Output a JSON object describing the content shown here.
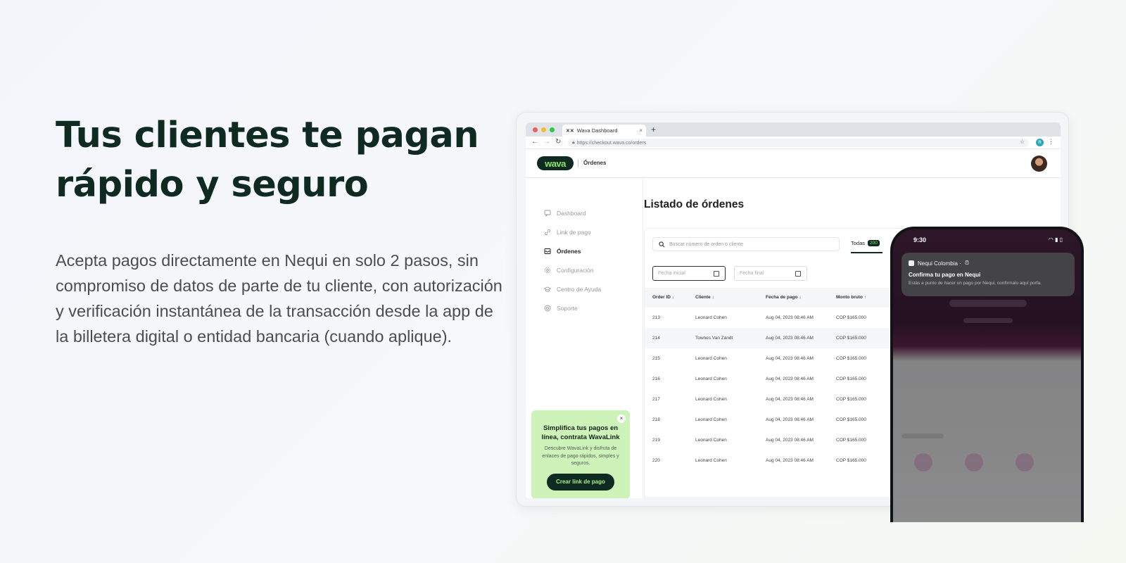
{
  "hero": {
    "title_line1": "Tus clientes te pagan",
    "title_line2": "rápido y seguro",
    "description": "Acepta pagos directamente en Nequi en solo 2 pasos, sin compromiso de datos de parte de tu cliente, con autorización y verificación instantánea de la transacción desde la app de la billetera digital o entidad bancaria (cuando aplique)."
  },
  "browser": {
    "tab_title": "Wava Dashboard",
    "url": "https://checkout.wava.co/orders",
    "profile_initial": "R"
  },
  "app": {
    "logo": "wava",
    "header_section": "Órdenes",
    "sidebar": [
      {
        "label": "Dashboard",
        "icon": "chat-icon",
        "active": false
      },
      {
        "label": "Link de pago",
        "icon": "link-icon",
        "active": false
      },
      {
        "label": "Órdenes",
        "icon": "inbox-icon",
        "active": true
      },
      {
        "label": "Configuración",
        "icon": "gear-icon",
        "active": false
      },
      {
        "label": "Centro de Ayuda",
        "icon": "graduation-cap-icon",
        "active": false
      },
      {
        "label": "Soporte",
        "icon": "support-icon",
        "active": false
      }
    ],
    "promo": {
      "title": "Simplifica tus pagos en línea, contrata WavaLink",
      "description": "Descubre WavaLink y disfruta de enlaces de pago rápidos, simples y seguros.",
      "button": "Crear link de pago"
    },
    "page_title": "Listado de órdenes",
    "search_placeholder": "Buscar número de orden o cliente",
    "tab_all": "Todas",
    "tab_all_count": "200",
    "date_start_placeholder": "Fecha inicial",
    "date_end_placeholder": "Fecha final",
    "table": {
      "headers": [
        "Order ID ↓",
        "Cliente ↓",
        "Fecha de pago ↓",
        "Monto bruto ↑"
      ],
      "rows": [
        [
          "213",
          "Leonard Cohen",
          "Aug 04, 2023 08:46 AM",
          "COP $165.000"
        ],
        [
          "214",
          "Townes Van Zandt",
          "Aug 04, 2023 08:46 AM",
          "COP $165.000"
        ],
        [
          "215",
          "Leonard Cohen",
          "Aug 04, 2023 08:46 AM",
          "COP $165.000"
        ],
        [
          "216",
          "Leonard Cohen",
          "Aug 04, 2023 08:46 AM",
          "COP $165.000"
        ],
        [
          "217",
          "Leonard Cohen",
          "Aug 04, 2023 08:46 AM",
          "COP $165.000"
        ],
        [
          "218",
          "Leonard Cohen",
          "Aug 04, 2023 08:46 AM",
          "COP $165.000"
        ],
        [
          "219",
          "Leonard Cohen",
          "Aug 04, 2023 08:46 AM",
          "COP $165.000"
        ],
        [
          "220",
          "Leonard Cohen",
          "Aug 04, 2023 08:46 AM",
          "COP $165.000"
        ]
      ]
    }
  },
  "phone": {
    "time": "9:30",
    "notification": {
      "app": "Nequi Colombia ·",
      "title": "Confirma tu pago en Nequi",
      "body": "Estás a punto de hacer un pago por Nequi, confírmalo aquí porfa."
    }
  },
  "colors": {
    "brand_dark": "#0f2a20",
    "brand_green": "#8fe36b",
    "promo_bg": "#cdf3b8"
  }
}
